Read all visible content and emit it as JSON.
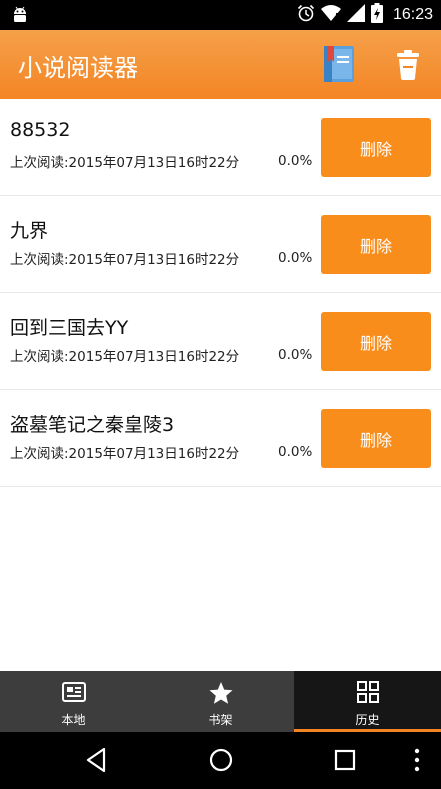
{
  "status_bar": {
    "time": "16:23",
    "icons": [
      "android-icon",
      "alarm-icon",
      "wifi-icon",
      "signal-icon",
      "battery-icon"
    ]
  },
  "action_bar": {
    "title": "小说阅读器",
    "actions": [
      {
        "name": "bookshelf-icon"
      },
      {
        "name": "trash-icon"
      }
    ]
  },
  "books": [
    {
      "title": "88532",
      "last_read": "上次阅读:2015年07月13日16时22分",
      "progress": "0.0%",
      "delete_label": "删除"
    },
    {
      "title": "九界",
      "last_read": "上次阅读:2015年07月13日16时22分",
      "progress": "0.0%",
      "delete_label": "删除"
    },
    {
      "title": "回到三国去YY",
      "last_read": "上次阅读:2015年07月13日16时22分",
      "progress": "0.0%",
      "delete_label": "删除"
    },
    {
      "title": "盗墓笔记之秦皇陵3",
      "last_read": "上次阅读:2015年07月13日16时22分",
      "progress": "0.0%",
      "delete_label": "删除"
    }
  ],
  "tabs": [
    {
      "label": "本地",
      "icon": "newspaper-icon",
      "active": false
    },
    {
      "label": "书架",
      "icon": "star-icon",
      "active": false
    },
    {
      "label": "历史",
      "icon": "grid-icon",
      "active": true
    }
  ],
  "nav_bar": {
    "buttons": [
      "back-icon",
      "home-icon",
      "recents-icon",
      "menu-icon"
    ]
  },
  "colors": {
    "accent": "#f48524",
    "button": "#f98d1b",
    "tabbar": "#3d3d3d"
  }
}
